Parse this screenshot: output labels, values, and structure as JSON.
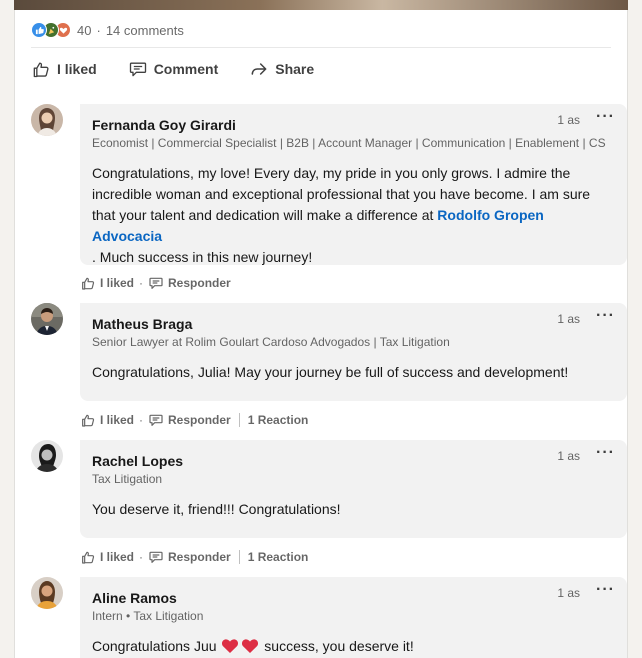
{
  "social": {
    "reaction_icons": [
      "like-icon",
      "celebrate-icon",
      "love-icon"
    ],
    "reaction_count": "40",
    "separator": "·",
    "comments_count": "14 comments"
  },
  "actions": {
    "like_label": "I liked",
    "comment_label": "Comment",
    "share_label": "Share"
  },
  "comments": [
    {
      "name": "Fernanda Goy Girardi",
      "headline": "Economist | Commercial Specialist | B2B | Account Manager | Communication | Enablement | CS",
      "time": "1 as",
      "more": "···",
      "text_before": "Congratulations, my love! Every day, my pride in you only grows. I admire the incredible woman and exceptional professional that you have become. I am sure that your talent and dedication will make a difference at ",
      "mention": "Rodolfo Gropen Advocacia",
      "text_after": ". Much success in this new journey!",
      "like_label": "I liked",
      "reply_label": "Responder"
    },
    {
      "name": "Matheus Braga",
      "headline": "Senior Lawyer at Rolim Goulart Cardoso Advogados | Tax Litigation",
      "time": "1 as",
      "more": "···",
      "text": "Congratulations, Julia! May your journey be full of success and development!",
      "like_label": "I liked",
      "reply_label": "Responder",
      "reactions_label": "1 Reaction"
    },
    {
      "name": "Rachel Lopes",
      "headline": "Tax Litigation",
      "time": "1 as",
      "more": "···",
      "text": "You deserve it, friend!!! Congratulations!",
      "like_label": "I liked",
      "reply_label": "Responder",
      "reactions_label": "1 Reaction"
    },
    {
      "name": "Aline Ramos",
      "headline": "Intern • Tax Litigation",
      "time": "1 as",
      "more": "···",
      "text_before": "Congratulations Juu ",
      "emoji": [
        "red-heart",
        "red-heart"
      ],
      "text_after": " success, you deserve it!"
    }
  ],
  "colors": {
    "link": "#0a66c2",
    "bubble": "#f2f2f2",
    "like_reaction": "#378fe9",
    "celebrate_reaction": "#44712e",
    "love_reaction": "#df704d"
  }
}
